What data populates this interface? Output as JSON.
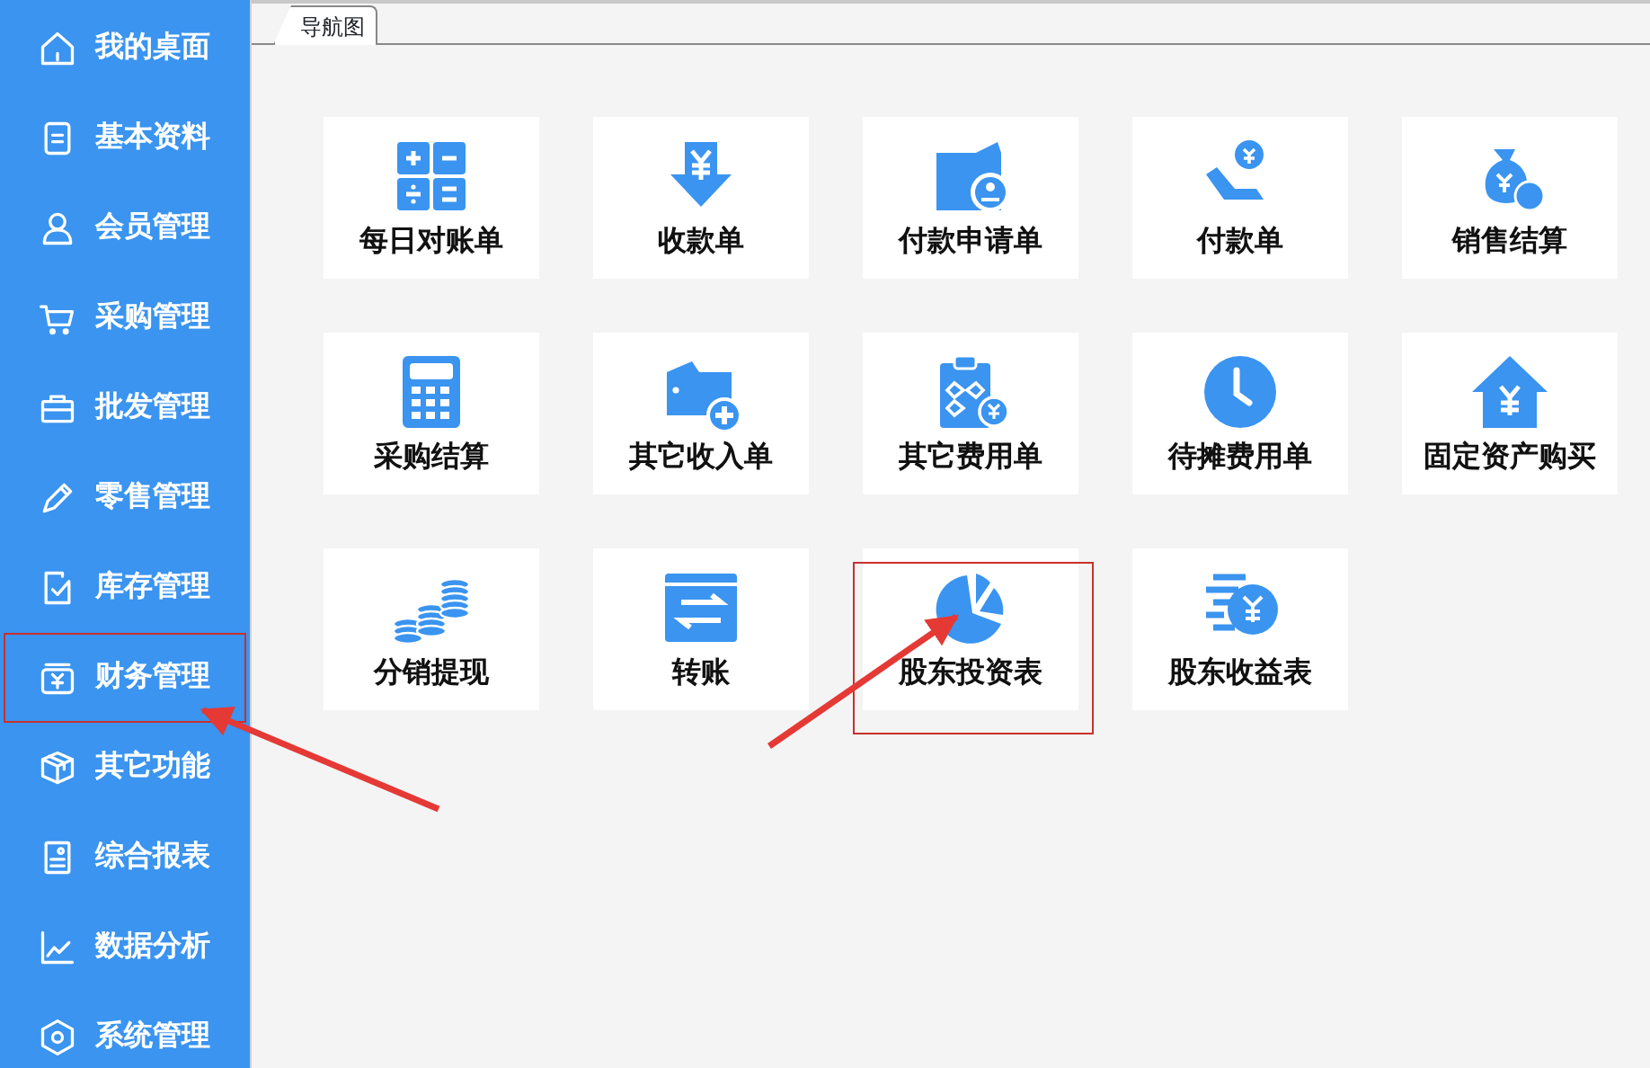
{
  "sidebar": {
    "items": [
      {
        "label": "我的桌面",
        "highlighted": false
      },
      {
        "label": "基本资料",
        "highlighted": false
      },
      {
        "label": "会员管理",
        "highlighted": false
      },
      {
        "label": "采购管理",
        "highlighted": false
      },
      {
        "label": "批发管理",
        "highlighted": false
      },
      {
        "label": "零售管理",
        "highlighted": false
      },
      {
        "label": "库存管理",
        "highlighted": false
      },
      {
        "label": "财务管理",
        "highlighted": true
      },
      {
        "label": "其它功能",
        "highlighted": false
      },
      {
        "label": "综合报表",
        "highlighted": false
      },
      {
        "label": "数据分析",
        "highlighted": false
      },
      {
        "label": "系统管理",
        "highlighted": false
      }
    ]
  },
  "tabs": [
    {
      "label": "导航图",
      "selected": true
    }
  ],
  "tiles": [
    {
      "label": "每日对账单",
      "highlighted": false
    },
    {
      "label": "收款单",
      "highlighted": false
    },
    {
      "label": "付款申请单",
      "highlighted": false
    },
    {
      "label": "付款单",
      "highlighted": false
    },
    {
      "label": "销售结算",
      "highlighted": false
    },
    {
      "label": "采购结算",
      "highlighted": false
    },
    {
      "label": "其它收入单",
      "highlighted": false
    },
    {
      "label": "其它费用单",
      "highlighted": false
    },
    {
      "label": "待摊费用单",
      "highlighted": false
    },
    {
      "label": "固定资产购买",
      "highlighted": false
    },
    {
      "label": "分销提现",
      "highlighted": false
    },
    {
      "label": "转账",
      "highlighted": false
    },
    {
      "label": "股东投资表",
      "highlighted": true
    },
    {
      "label": "股东收益表",
      "highlighted": false
    }
  ]
}
